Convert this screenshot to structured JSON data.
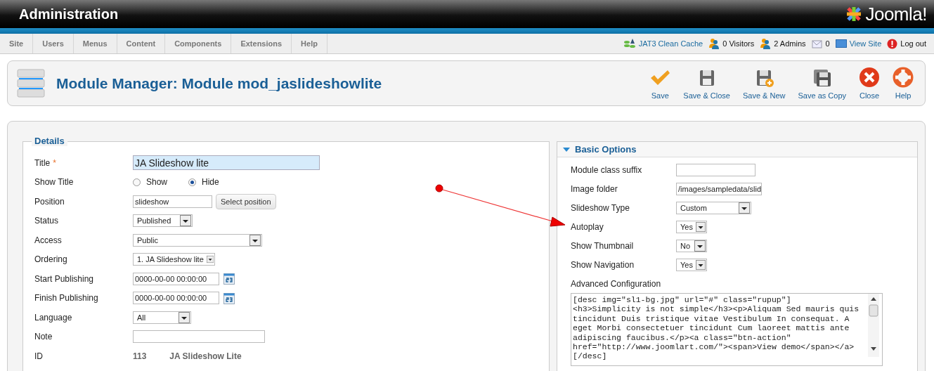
{
  "header": {
    "title": "Administration",
    "logo": "Joomla!"
  },
  "menu": [
    "Site",
    "Users",
    "Menus",
    "Content",
    "Components",
    "Extensions",
    "Help"
  ],
  "status": [
    {
      "kind": "cache",
      "label": "JAT3 Clean Cache",
      "link": true
    },
    {
      "kind": "visitors",
      "label": "0 Visitors",
      "link": false
    },
    {
      "kind": "admins",
      "label": "2 Admins",
      "link": false
    },
    {
      "kind": "messages",
      "label": "0",
      "link": false
    },
    {
      "kind": "site",
      "label": "View Site",
      "link": true
    },
    {
      "kind": "logout",
      "label": "Log out",
      "link": false
    }
  ],
  "toolbar": {
    "title": "Module Manager: Module mod_jaslideshowlite",
    "buttons": [
      {
        "kind": "save",
        "label": "Save"
      },
      {
        "kind": "save-close",
        "label": "Save & Close"
      },
      {
        "kind": "save-new",
        "label": "Save & New"
      },
      {
        "kind": "save-copy",
        "label": "Save as Copy"
      },
      {
        "kind": "close",
        "label": "Close"
      },
      {
        "kind": "help",
        "label": "Help"
      }
    ]
  },
  "details": {
    "legend": "Details",
    "fields": [
      {
        "kind": "text",
        "label": "Title",
        "marker": "*",
        "value": "JA Slideshow lite",
        "focused": true
      },
      {
        "kind": "radio",
        "label": "Show Title",
        "options": [
          {
            "label": "Show",
            "selected": false
          },
          {
            "label": "Hide",
            "selected": true
          }
        ]
      },
      {
        "kind": "text-button",
        "label": "Position",
        "value": "slideshow",
        "button": "Select position"
      },
      {
        "kind": "select",
        "label": "Status",
        "value": "Published"
      },
      {
        "kind": "select",
        "label": "Access",
        "value": "Public"
      },
      {
        "kind": "select",
        "label": "Ordering",
        "value": "1. JA Slideshow lite"
      },
      {
        "kind": "date",
        "label": "Start Publishing",
        "value": "0000-00-00 00:00:00"
      },
      {
        "kind": "date",
        "label": "Finish Publishing",
        "value": "0000-00-00 00:00:00"
      },
      {
        "kind": "select",
        "label": "Language",
        "value": "All"
      },
      {
        "kind": "text",
        "label": "Note",
        "focused": false
      },
      {
        "kind": "static",
        "label": "ID",
        "value": "113",
        "extra": "JA Slideshow Lite"
      }
    ]
  },
  "basic_options": {
    "title": "Basic Options",
    "expanded": true,
    "fields": [
      {
        "kind": "text",
        "label": "Module class suffix"
      },
      {
        "kind": "text",
        "label": "Image folder",
        "value": "/images/sampledata/slid"
      },
      {
        "kind": "select",
        "label": "Slideshow Type",
        "value": "Custom"
      },
      {
        "kind": "select",
        "label": "Autoplay",
        "value": "Yes"
      },
      {
        "kind": "select",
        "label": "Show Thumbnail",
        "value": "No"
      },
      {
        "kind": "select",
        "label": "Show Navigation",
        "value": "Yes"
      }
    ],
    "advanced": {
      "label": "Advanced Configuration",
      "value": "[desc img=\"sl1-bg.jpg\" url=\"#\" class=\"rupup\"]\n<h3>Simplicity is not simple</h3><p>Aliquam Sed mauris quis tincidunt Duis tristique vitae Vestibulum In consequat. A eget Morbi consectetuer tincidunt Cum laoreet mattis ante adipiscing faucibus.</p><a class=\"btn-action\" href=\"http://www.joomlart.com/\"><span>View demo</span></a>\n[/desc]"
    }
  }
}
